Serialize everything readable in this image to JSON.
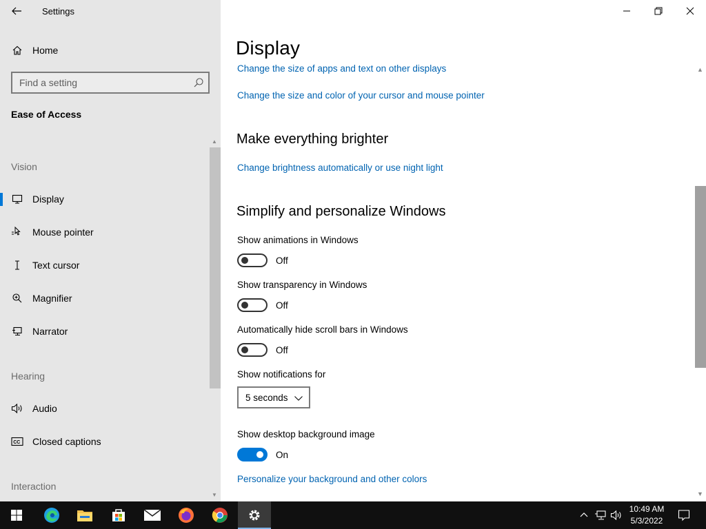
{
  "window": {
    "title": "Settings"
  },
  "sidebar": {
    "home_label": "Home",
    "search_placeholder": "Find a setting",
    "section_title": "Ease of Access",
    "groups": {
      "vision": "Vision",
      "hearing": "Hearing",
      "interaction": "Interaction"
    },
    "items": [
      {
        "label": "Display",
        "icon": "monitor-icon",
        "selected": true
      },
      {
        "label": "Mouse pointer",
        "icon": "mouse-pointer-icon"
      },
      {
        "label": "Text cursor",
        "icon": "text-cursor-icon"
      },
      {
        "label": "Magnifier",
        "icon": "magnifier-icon"
      },
      {
        "label": "Narrator",
        "icon": "narrator-icon"
      },
      {
        "label": "Audio",
        "icon": "speaker-icon"
      },
      {
        "label": "Closed captions",
        "icon": "closed-captions-icon"
      }
    ]
  },
  "main": {
    "page_title": "Display",
    "links": {
      "size_other_displays": "Change the size of apps and text on other displays",
      "cursor_size_color": "Change the size and color of your cursor and mouse pointer",
      "brightness_night_light": "Change brightness automatically or use night light",
      "personalize_background": "Personalize your background and other colors"
    },
    "headings": {
      "brighter": "Make everything brighter",
      "simplify": "Simplify and personalize Windows"
    },
    "settings": {
      "animations": {
        "label": "Show animations in Windows",
        "state": "Off",
        "on": false
      },
      "transparency": {
        "label": "Show transparency in Windows",
        "state": "Off",
        "on": false
      },
      "hide_scrollbars": {
        "label": "Automatically hide scroll bars in Windows",
        "state": "Off",
        "on": false
      },
      "notifications": {
        "label": "Show notifications for",
        "value": "5 seconds"
      },
      "desktop_background": {
        "label": "Show desktop background image",
        "state": "On",
        "on": true
      }
    }
  },
  "taskbar": {
    "apps": [
      "start-icon",
      "edge-icon",
      "file-explorer-icon",
      "store-icon",
      "mail-icon",
      "firefox-icon",
      "chrome-icon",
      "settings-icon"
    ],
    "clock_time": "10:49 AM",
    "clock_date": "5/3/2022"
  },
  "colors": {
    "accent": "#0078d7",
    "link": "#0063b1",
    "sidebar_bg": "#e6e6e6",
    "taskbar_bg": "#101010"
  }
}
